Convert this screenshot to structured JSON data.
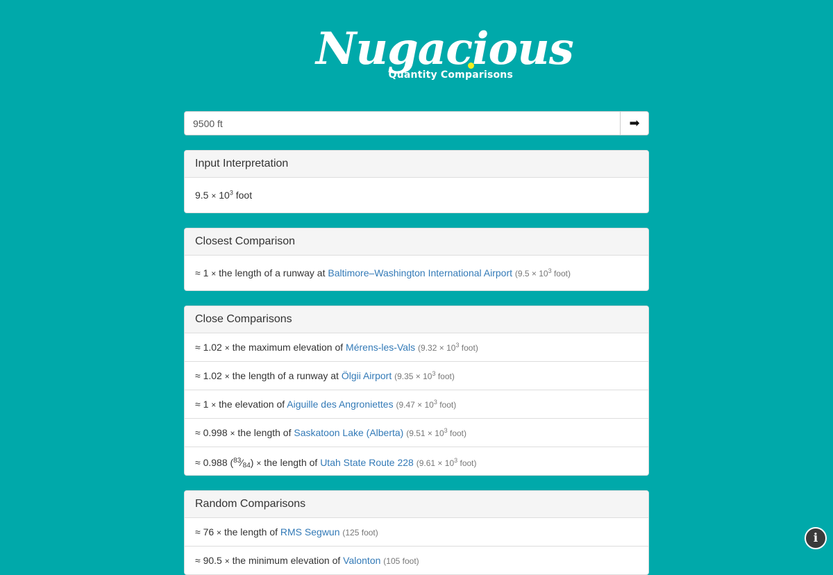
{
  "brand": {
    "name": "Nugacious",
    "tagline": "Quantity Comparisons"
  },
  "search": {
    "value": "9500 ft",
    "submit_icon": "arrow-right-icon"
  },
  "input_interpretation": {
    "heading": "Input Interpretation",
    "mantissa": "9.5",
    "times": "×",
    "base": "10",
    "exp": "3",
    "unit": "foot"
  },
  "closest": {
    "heading": "Closest Comparison",
    "item": {
      "approx": "≈ 1",
      "times": "×",
      "text": "the length of a runway at",
      "link": "Baltimore–Washington International Airport",
      "qty": "9.5",
      "exp": "3",
      "unit": "foot"
    }
  },
  "close": {
    "heading": "Close Comparisons",
    "items": [
      {
        "approx": "≈ 1.02",
        "times": "×",
        "text": "the maximum elevation of",
        "link": "Mérens-les-Vals",
        "qty": "9.32",
        "exp": "3",
        "unit": "foot"
      },
      {
        "approx": "≈ 1.02",
        "times": "×",
        "text": "the length of a runway at",
        "link": "Ölgii Airport",
        "qty": "9.35",
        "exp": "3",
        "unit": "foot"
      },
      {
        "approx": "≈ 1",
        "times": "×",
        "text": "the elevation of",
        "link": "Aiguille des Angroniettes",
        "qty": "9.47",
        "exp": "3",
        "unit": "foot"
      },
      {
        "approx": "≈ 0.998",
        "times": "×",
        "text": "the length of",
        "link": "Saskatoon Lake (Alberta)",
        "qty": "9.51",
        "exp": "3",
        "unit": "foot"
      },
      {
        "approx": "≈ 0.988",
        "frac_num": "83",
        "frac_den": "84",
        "times": "×",
        "text": "the length of",
        "link": "Utah State Route 228",
        "qty": "9.61",
        "exp": "3",
        "unit": "foot"
      }
    ]
  },
  "random": {
    "heading": "Random Comparisons",
    "items": [
      {
        "approx": "≈ 76",
        "times": "×",
        "text": "the length of",
        "link": "RMS Segwun",
        "qty": "(125 foot)"
      },
      {
        "approx": "≈ 90.5",
        "times": "×",
        "text": "the minimum elevation of",
        "link": "Valonton",
        "qty": "(105 foot)"
      }
    ]
  },
  "info_icon": "info-icon"
}
